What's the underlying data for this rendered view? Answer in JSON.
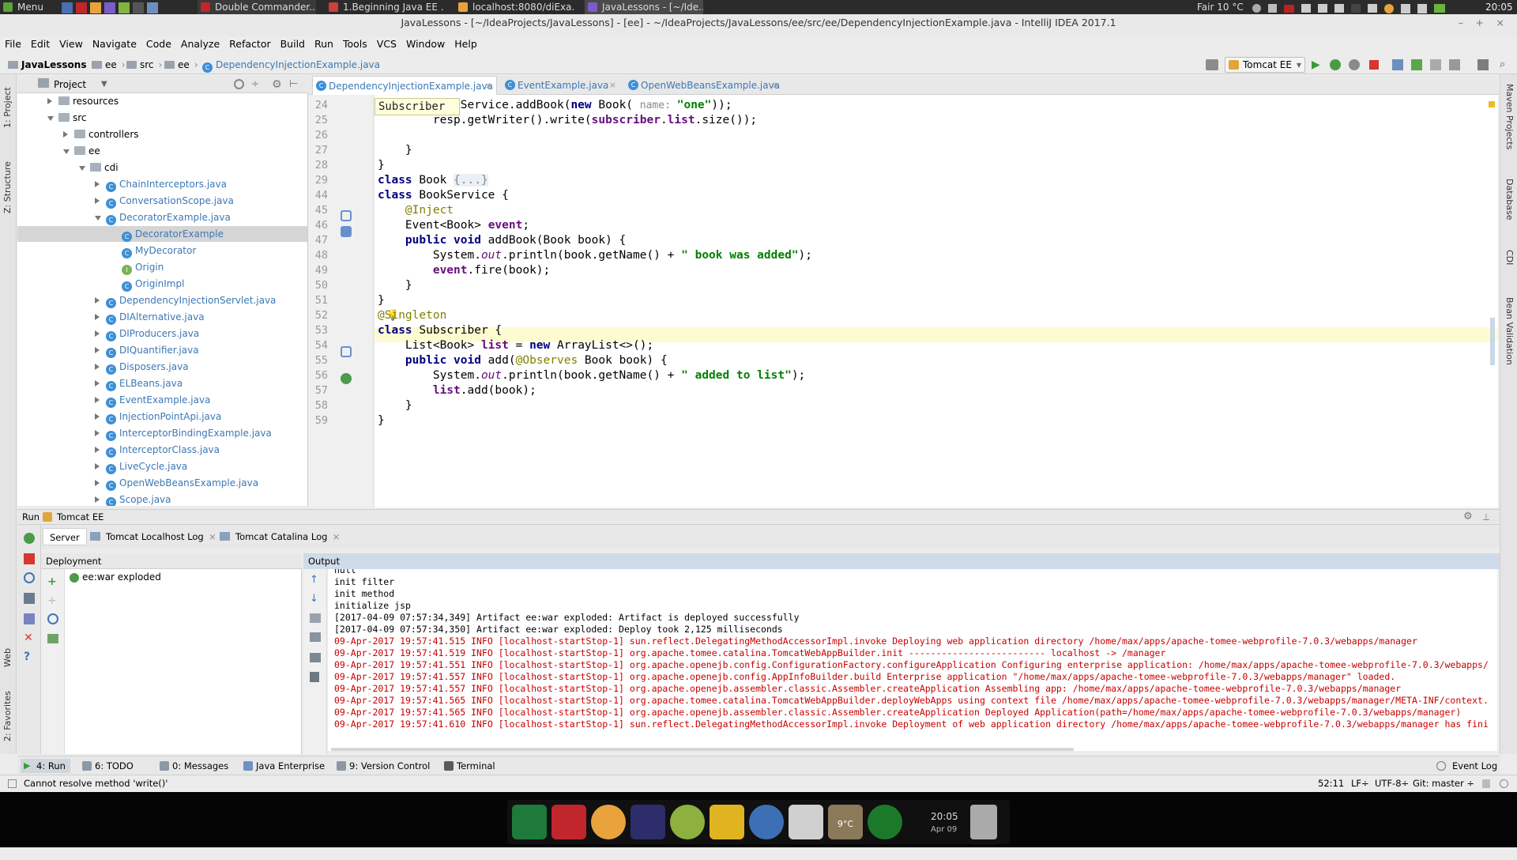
{
  "os_panel": {
    "menu_label": "Menu",
    "tasks": [
      "Double Commander...",
      "1.Beginning Java EE ...",
      "localhost:8080/diExa...",
      "JavaLessons - [~/Ide..."
    ],
    "weather": "Fair 10 °C",
    "clock": "20:05"
  },
  "window": {
    "title": "JavaLessons - [~/IdeaProjects/JavaLessons] - [ee] - ~/IdeaProjects/JavaLessons/ee/src/ee/DependencyInjectionExample.java - IntelliJ IDEA 2017.1"
  },
  "menu": [
    "File",
    "Edit",
    "View",
    "Navigate",
    "Code",
    "Analyze",
    "Refactor",
    "Build",
    "Run",
    "Tools",
    "VCS",
    "Window",
    "Help"
  ],
  "breadcrumbs": [
    "JavaLessons",
    "ee",
    "src",
    "ee",
    "DependencyInjectionExample.java"
  ],
  "run_config": "Tomcat EE",
  "left_strip": [
    "1: Project",
    "Z: Structure",
    "Web",
    "2: Favorites"
  ],
  "right_strip": [
    "Maven Projects",
    "Database",
    "CDI",
    "Bean Validation"
  ],
  "project_panel": {
    "title": "Project",
    "tree": [
      {
        "label": "resources",
        "kind": "folder",
        "depth": 2,
        "arrow": "right"
      },
      {
        "label": "src",
        "kind": "folder",
        "depth": 2,
        "arrow": "down"
      },
      {
        "label": "controllers",
        "kind": "folder",
        "depth": 3,
        "arrow": "right"
      },
      {
        "label": "ee",
        "kind": "folder",
        "depth": 3,
        "arrow": "down"
      },
      {
        "label": "cdi",
        "kind": "folder",
        "depth": 4,
        "arrow": "down"
      },
      {
        "label": "ChainInterceptors.java",
        "kind": "class",
        "depth": 5,
        "arrow": "right"
      },
      {
        "label": "ConversationScope.java",
        "kind": "class",
        "depth": 5,
        "arrow": "right"
      },
      {
        "label": "DecoratorExample.java",
        "kind": "class",
        "depth": 5,
        "arrow": "down"
      },
      {
        "label": "DecoratorExample",
        "kind": "class",
        "depth": 6,
        "arrow": "",
        "selected": true
      },
      {
        "label": "MyDecorator",
        "kind": "class",
        "depth": 6,
        "arrow": ""
      },
      {
        "label": "Origin",
        "kind": "interface",
        "depth": 6,
        "arrow": ""
      },
      {
        "label": "OriginImpl",
        "kind": "class",
        "depth": 6,
        "arrow": ""
      },
      {
        "label": "DependencyInjectionServlet.java",
        "kind": "class",
        "depth": 5,
        "arrow": "right"
      },
      {
        "label": "DIAlternative.java",
        "kind": "class",
        "depth": 5,
        "arrow": "right"
      },
      {
        "label": "DIProducers.java",
        "kind": "class",
        "depth": 5,
        "arrow": "right"
      },
      {
        "label": "DIQuantifier.java",
        "kind": "class",
        "depth": 5,
        "arrow": "right"
      },
      {
        "label": "Disposers.java",
        "kind": "class",
        "depth": 5,
        "arrow": "right"
      },
      {
        "label": "ELBeans.java",
        "kind": "class",
        "depth": 5,
        "arrow": "right"
      },
      {
        "label": "EventExample.java",
        "kind": "class",
        "depth": 5,
        "arrow": "right"
      },
      {
        "label": "InjectionPointApi.java",
        "kind": "class",
        "depth": 5,
        "arrow": "right"
      },
      {
        "label": "InterceptorBindingExample.java",
        "kind": "class",
        "depth": 5,
        "arrow": "right"
      },
      {
        "label": "InterceptorClass.java",
        "kind": "class",
        "depth": 5,
        "arrow": "right"
      },
      {
        "label": "LiveCycle.java",
        "kind": "class",
        "depth": 5,
        "arrow": "right"
      },
      {
        "label": "OpenWebBeansExample.java",
        "kind": "class",
        "depth": 5,
        "arrow": "right"
      },
      {
        "label": "Scope.java",
        "kind": "class",
        "depth": 5,
        "arrow": "right"
      }
    ]
  },
  "editor": {
    "tabs": [
      {
        "label": "DependencyInjectionExample.java",
        "active": true
      },
      {
        "label": "EventExample.java",
        "active": false
      },
      {
        "label": "OpenWebBeansExample.java",
        "active": false
      }
    ],
    "tooltip": "Subscriber",
    "lines": [
      {
        "n": "24",
        "html": "        <span>bookService.addBook(</span><span class=\"kw\">new</span> Book( <span class=\"hint\">name: </span><span class=\"st\">\"one\"</span>));"
      },
      {
        "n": "25",
        "html": "        resp.getWriter().write(<span class=\"fd\">subscriber</span>.<span class=\"fd\">list</span>.size());"
      },
      {
        "n": "26",
        "html": ""
      },
      {
        "n": "27",
        "html": "    }"
      },
      {
        "n": "28",
        "html": "}"
      },
      {
        "n": "29",
        "html": "<span class=\"kw\">class</span> Book <span class=\"fold2\">{...}</span>"
      },
      {
        "n": "44",
        "html": "<span class=\"kw\">class</span> BookService {"
      },
      {
        "n": "45",
        "html": "    <span class=\"an\">@Inject</span>"
      },
      {
        "n": "46",
        "html": "    Event&lt;Book&gt; <span class=\"fd\">event</span>;"
      },
      {
        "n": "47",
        "html": "    <span class=\"kw\">public void</span> addBook(Book book) {"
      },
      {
        "n": "48",
        "html": "        System.<span class=\"it\">out</span>.println(book.getName() + <span class=\"st\">\" book was added\"</span>);"
      },
      {
        "n": "49",
        "html": "        <span class=\"fd\">event</span>.fire(book);"
      },
      {
        "n": "50",
        "html": "    }"
      },
      {
        "n": "51",
        "html": "}"
      },
      {
        "n": "52",
        "html": "<span class=\"an\">@Singleton</span>"
      },
      {
        "n": "53",
        "html": "<span class=\"kw\">class</span> Subscriber {"
      },
      {
        "n": "54",
        "html": "    List&lt;Book&gt; <span class=\"fd\">list</span> = <span class=\"kw\">new</span> ArrayList&lt;&gt;();"
      },
      {
        "n": "55",
        "html": "    <span class=\"kw\">public void</span> add(<span class=\"an\">@Observes</span> Book book) {"
      },
      {
        "n": "56",
        "html": "        System.<span class=\"it\">out</span>.println(book.getName() + <span class=\"st\">\" added to list\"</span>);"
      },
      {
        "n": "57",
        "html": "        <span class=\"fd\">list</span>.add(book);"
      },
      {
        "n": "58",
        "html": "    }"
      },
      {
        "n": "59",
        "html": "}"
      }
    ]
  },
  "run_panel": {
    "header": "Run",
    "config": "Tomcat EE",
    "tabs": [
      "Server",
      "Tomcat Localhost Log",
      "Tomcat Catalina Log"
    ],
    "deployment_header": "Deployment",
    "deployment_item": "ee:war exploded",
    "output_header": "Output",
    "output_lines": [
      {
        "text": "null",
        "red": false
      },
      {
        "text": "init filter",
        "red": false
      },
      {
        "text": "init method",
        "red": false
      },
      {
        "text": "initialize jsp",
        "red": false
      },
      {
        "text": "[2017-04-09 07:57:34,349] Artifact ee:war exploded: Artifact is deployed successfully",
        "red": false
      },
      {
        "text": "[2017-04-09 07:57:34,350] Artifact ee:war exploded: Deploy took 2,125 milliseconds",
        "red": false
      },
      {
        "text": "09-Apr-2017 19:57:41.515 INFO [localhost-startStop-1] sun.reflect.DelegatingMethodAccessorImpl.invoke Deploying web application directory /home/max/apps/apache-tomee-webprofile-7.0.3/webapps/manager",
        "red": true
      },
      {
        "text": "09-Apr-2017 19:57:41.519 INFO [localhost-startStop-1] org.apache.tomee.catalina.TomcatWebAppBuilder.init ------------------------- localhost -> /manager",
        "red": true
      },
      {
        "text": "09-Apr-2017 19:57:41.551 INFO [localhost-startStop-1] org.apache.openejb.config.ConfigurationFactory.configureApplication Configuring enterprise application: /home/max/apps/apache-tomee-webprofile-7.0.3/webapps/",
        "red": true
      },
      {
        "text": "09-Apr-2017 19:57:41.557 INFO [localhost-startStop-1] org.apache.openejb.config.AppInfoBuilder.build Enterprise application \"/home/max/apps/apache-tomee-webprofile-7.0.3/webapps/manager\" loaded.",
        "red": true
      },
      {
        "text": "09-Apr-2017 19:57:41.557 INFO [localhost-startStop-1] org.apache.openejb.assembler.classic.Assembler.createApplication Assembling app: /home/max/apps/apache-tomee-webprofile-7.0.3/webapps/manager",
        "red": true
      },
      {
        "text": "09-Apr-2017 19:57:41.565 INFO [localhost-startStop-1] org.apache.tomee.catalina.TomcatWebAppBuilder.deployWebApps using context file /home/max/apps/apache-tomee-webprofile-7.0.3/webapps/manager/META-INF/context.",
        "red": true
      },
      {
        "text": "09-Apr-2017 19:57:41.565 INFO [localhost-startStop-1] org.apache.openejb.assembler.classic.Assembler.createApplication Deployed Application(path=/home/max/apps/apache-tomee-webprofile-7.0.3/webapps/manager)",
        "red": true
      },
      {
        "text": "09-Apr-2017 19:57:41.610 INFO [localhost-startStop-1] sun.reflect.DelegatingMethodAccessorImpl.invoke Deployment of web application directory /home/max/apps/apache-tomee-webprofile-7.0.3/webapps/manager has fini",
        "red": true
      }
    ]
  },
  "tool_windows": [
    "4: Run",
    "6: TODO",
    "0: Messages",
    "Java Enterprise",
    "9: Version Control",
    "Terminal"
  ],
  "event_log": "Event Log",
  "status": {
    "message": "Cannot resolve method 'write()'",
    "position": "52:11",
    "line_sep": "LF÷",
    "encoding": "UTF-8÷",
    "git": "Git: master ÷"
  },
  "dock": {
    "clock": "20:05",
    "date": "Apr 09",
    "weather_temp": "9°C"
  },
  "colors": {
    "accent": "#3c78b5",
    "selection": "#d5d5d5",
    "error_text": "#c80000"
  }
}
